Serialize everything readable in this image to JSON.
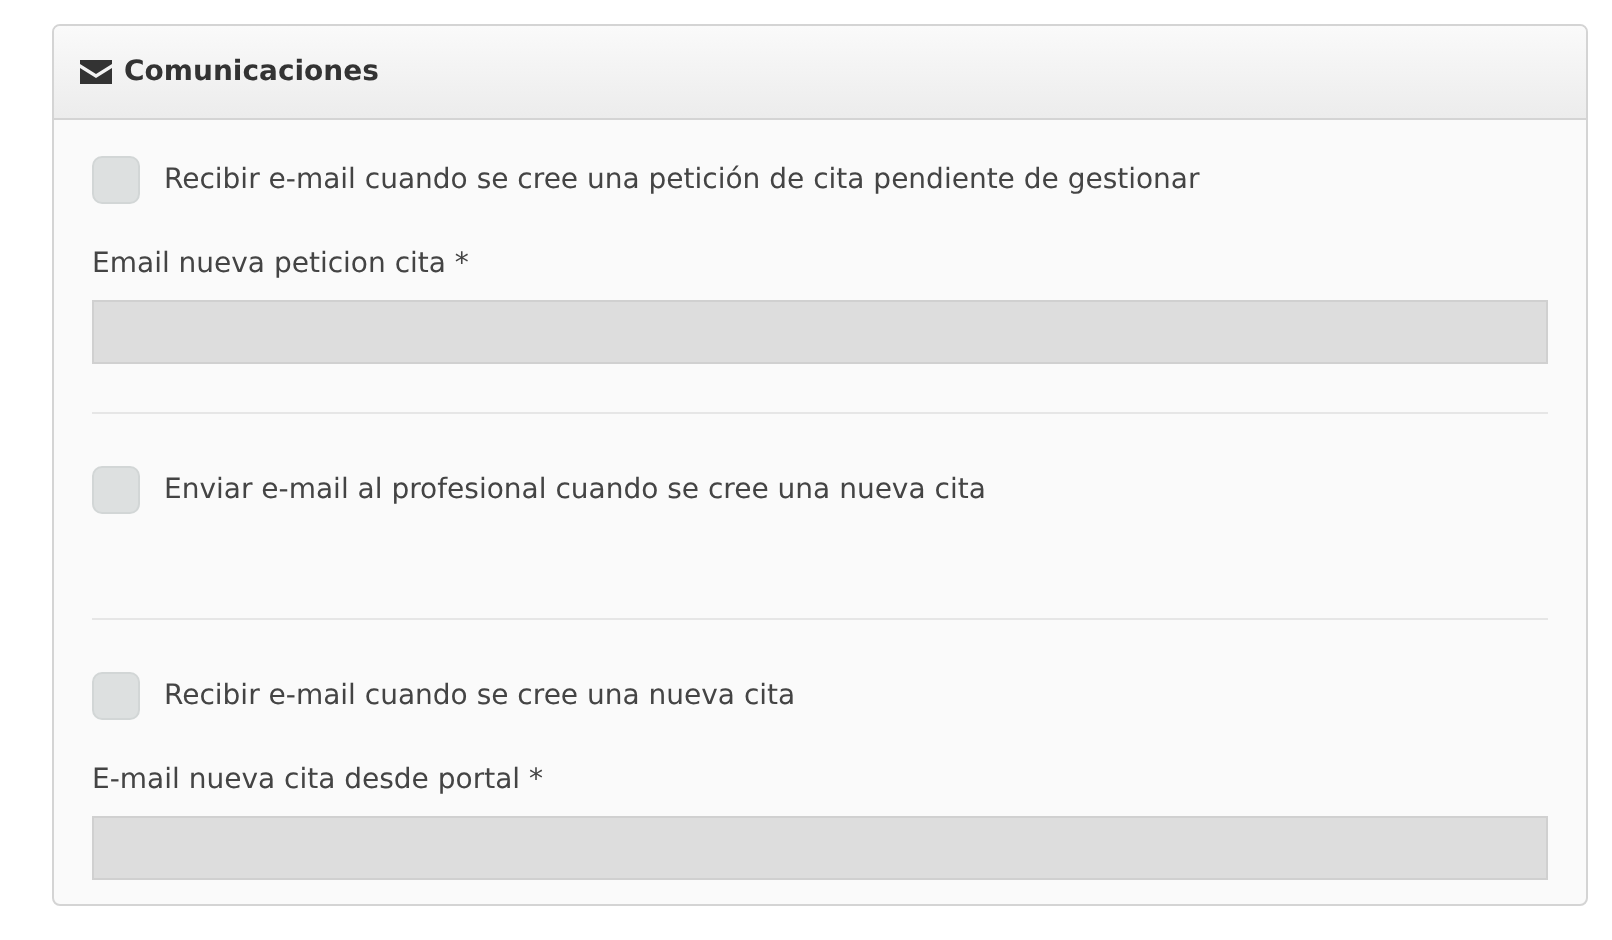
{
  "panel": {
    "title": "Comunicaciones"
  },
  "sections": [
    {
      "checkbox": {
        "label": "Recibir e-mail cuando se cree una petición de cita pendiente de gestionar",
        "checked": false
      },
      "field": {
        "label": "Email nueva peticion cita *",
        "disabled": true
      }
    },
    {
      "checkbox": {
        "label": "Enviar e-mail al profesional cuando se cree una nueva cita",
        "checked": false
      }
    },
    {
      "checkbox": {
        "label": "Recibir e-mail cuando se cree una nueva cita",
        "checked": false
      },
      "field": {
        "label": "E-mail nueva cita desde portal *",
        "disabled": true
      }
    }
  ]
}
